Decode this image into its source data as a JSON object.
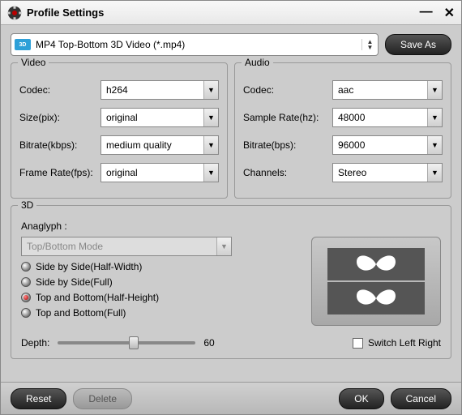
{
  "window": {
    "title": "Profile Settings"
  },
  "top": {
    "profile_name": "MP4 Top-Bottom 3D Video (*.mp4)",
    "profile_badge": "3D",
    "save_as": "Save As"
  },
  "video": {
    "legend": "Video",
    "codec_label": "Codec:",
    "codec_value": "h264",
    "size_label": "Size(pix):",
    "size_value": "original",
    "bitrate_label": "Bitrate(kbps):",
    "bitrate_value": "medium quality",
    "framerate_label": "Frame Rate(fps):",
    "framerate_value": "original"
  },
  "audio": {
    "legend": "Audio",
    "codec_label": "Codec:",
    "codec_value": "aac",
    "samplerate_label": "Sample Rate(hz):",
    "samplerate_value": "48000",
    "bitrate_label": "Bitrate(bps):",
    "bitrate_value": "96000",
    "channels_label": "Channels:",
    "channels_value": "Stereo"
  },
  "three_d": {
    "legend": "3D",
    "anaglyph_label": "Anaglyph :",
    "anaglyph_value": "Top/Bottom Mode",
    "radios": {
      "sbs_half": "Side by Side(Half-Width)",
      "sbs_full": "Side by Side(Full)",
      "tb_half": "Top and Bottom(Half-Height)",
      "tb_full": "Top and Bottom(Full)"
    },
    "selected": "tb_half",
    "depth_label": "Depth:",
    "depth_value": "60",
    "slider_percent": 55,
    "switch_label": "Switch Left Right",
    "switch_checked": false
  },
  "footer": {
    "reset": "Reset",
    "delete": "Delete",
    "ok": "OK",
    "cancel": "Cancel"
  }
}
